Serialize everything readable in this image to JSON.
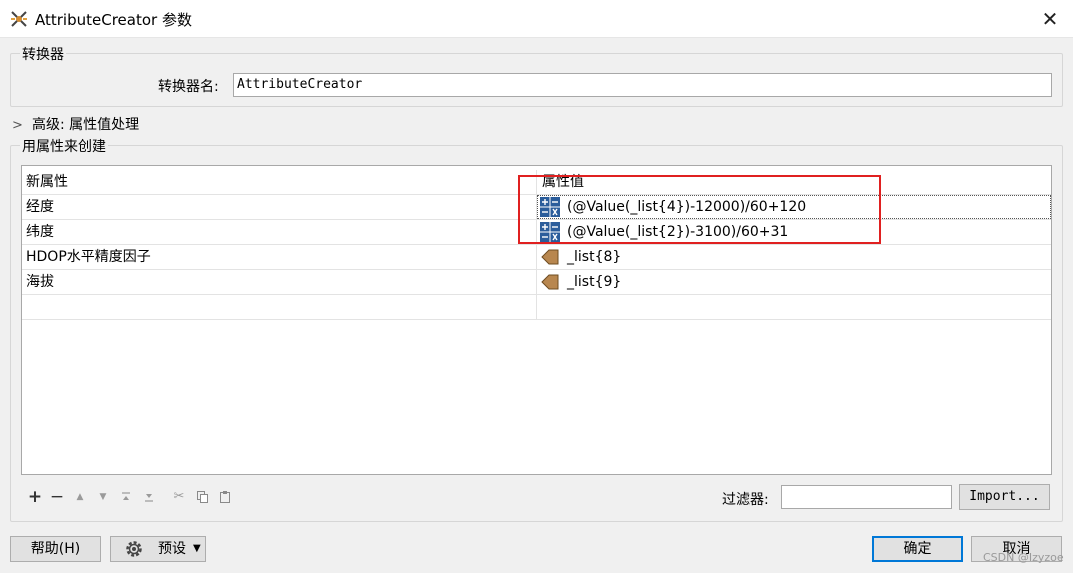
{
  "window": {
    "title": "AttributeCreator 参数"
  },
  "transformer": {
    "group_title": "转换器",
    "name_label": "转换器名:",
    "name_value": "AttributeCreator"
  },
  "advanced": {
    "label": "高级: 属性值处理"
  },
  "create": {
    "group_title": "用属性来创建",
    "columns": [
      "新属性",
      "属性值"
    ],
    "rows": [
      {
        "name": "经度",
        "value": "(@Value(_list{4})-12000)/60+120",
        "icon": "arithmetic-icon"
      },
      {
        "name": "纬度",
        "value": "(@Value(_list{2})-3100)/60+31",
        "icon": "arithmetic-icon"
      },
      {
        "name": "HDOP水平精度因子",
        "value": "_list{8}",
        "icon": "attribute-arrow-icon"
      },
      {
        "name": "海拔",
        "value": "_list{9}",
        "icon": "attribute-arrow-icon"
      }
    ]
  },
  "filter": {
    "label": "过滤器:",
    "value": "",
    "import_label": "Import..."
  },
  "footer": {
    "help_label": "帮助(H)",
    "preset_label": "预设",
    "ok_label": "确定",
    "cancel_label": "取消",
    "watermark": "CSDN @Izyzoe"
  },
  "colors": {
    "highlight": "#e02020",
    "arith_icon": "#2b5d9b",
    "arrow_icon": "#b8874f",
    "default_border": "#0078d7"
  }
}
